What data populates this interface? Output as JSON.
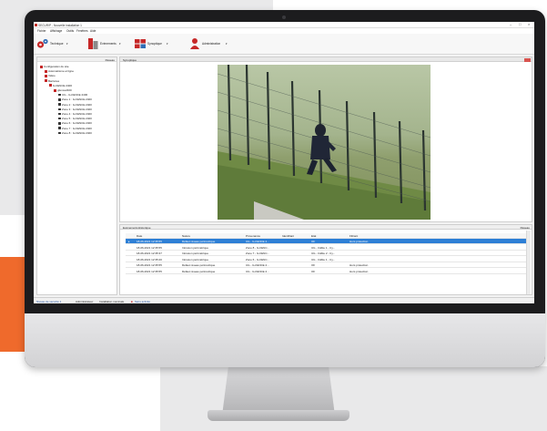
{
  "window": {
    "title": "SECUR/P - Nouvelle installation 1",
    "controls": [
      "–",
      "□",
      "×"
    ]
  },
  "menu": [
    "Fichier",
    "Affichage",
    "Outils",
    "Fenêtres",
    "Aide"
  ],
  "toolbar": [
    {
      "label": "Technique",
      "icon": "technique-icon"
    },
    {
      "label": "Evénements",
      "icon": "events-icon"
    },
    {
      "label": "Synoptique",
      "icon": "synoptic-icon"
    },
    {
      "label": "Administration",
      "icon": "administration-icon"
    }
  ],
  "tree": {
    "header": "Réseau",
    "nodes": [
      {
        "label": "Configuration du site",
        "indent": 0,
        "icon": "flag"
      },
      {
        "label": "Automatisme et ligne",
        "indent": 1,
        "icon": "flag"
      },
      {
        "label": "Vidéo",
        "indent": 1,
        "icon": "flag"
      },
      {
        "label": "Barrières",
        "indent": 1,
        "icon": "flag"
      },
      {
        "label": "G-FENCE 2400",
        "indent": 2,
        "icon": "flag"
      },
      {
        "label": "gfence2400",
        "indent": 3,
        "icon": "flag"
      },
      {
        "label": "UG - G-FENCE 2400",
        "indent": 4,
        "icon": "cam"
      },
      {
        "label": "Zone 1 : G-FENCE 2400",
        "indent": 4,
        "icon": "cam"
      },
      {
        "label": "Zone 2 : G-FENCE 2400",
        "indent": 4,
        "icon": "cam"
      },
      {
        "label": "Zone 3 : G-FENCE 2400",
        "indent": 4,
        "icon": "cam"
      },
      {
        "label": "Zone 4 : G-FENCE 2400",
        "indent": 4,
        "icon": "cam"
      },
      {
        "label": "Zone 5 : G-FENCE 2400",
        "indent": 4,
        "icon": "cam"
      },
      {
        "label": "Zone 6 : G-FENCE 2400",
        "indent": 4,
        "icon": "cam"
      },
      {
        "label": "Zone 7 : G-FENCE 2400",
        "indent": 4,
        "icon": "cam"
      },
      {
        "label": "Zone 8 : G-FENCE 2400",
        "indent": 4,
        "icon": "cam"
      }
    ]
  },
  "synoptic": {
    "title": "Synoptique"
  },
  "events": {
    "tabs": [
      "Evénements",
      "Historique"
    ],
    "right_label": "Réseau",
    "columns": [
      "Date",
      "Nature",
      "Provenance",
      "Identifiant",
      "Etat",
      "Filtrant"
    ],
    "rows": [
      [
        "18-06-2021 12:35:55",
        "Défaut réseau périmétrique",
        "UG - G-FENCE 2...",
        "",
        "OF",
        "Hors protection"
      ],
      [
        "18-06-2021 12:35:55",
        "Intrusion périmétrique",
        "Zone 8 - G-FENC...",
        "",
        "UG - Câble 1 - Cy...",
        ""
      ],
      [
        "18-06-2021 12:35:37",
        "Intrusion périmétrique",
        "Zone 7 - G-FENC...",
        "",
        "UG - Câble 2 - Cy...",
        ""
      ],
      [
        "18-06-2021 12:35:20",
        "Intrusion périmétrique",
        "Zone 6 - G-FENC...",
        "",
        "UG - Câble 1 - Cy...",
        ""
      ],
      [
        "18-06-2021 12:35:55",
        "Défaut réseau périmétrique",
        "UG - G-FENCE 2...",
        "",
        "OF",
        "Hors protection"
      ],
      [
        "18-06-2021 12:35:55",
        "Défaut réseau périmétrique",
        "UG - G-FENCE 2...",
        "",
        "OF",
        "Hors protection"
      ]
    ]
  },
  "status": [
    "Niveau de sécurité 1",
    "Administrateur",
    "Installation nominale",
    "Sans activité"
  ],
  "colors": {
    "brand_red": "#c62828",
    "selection": "#2d7fd6",
    "accent_orange": "#ef6a2c"
  }
}
